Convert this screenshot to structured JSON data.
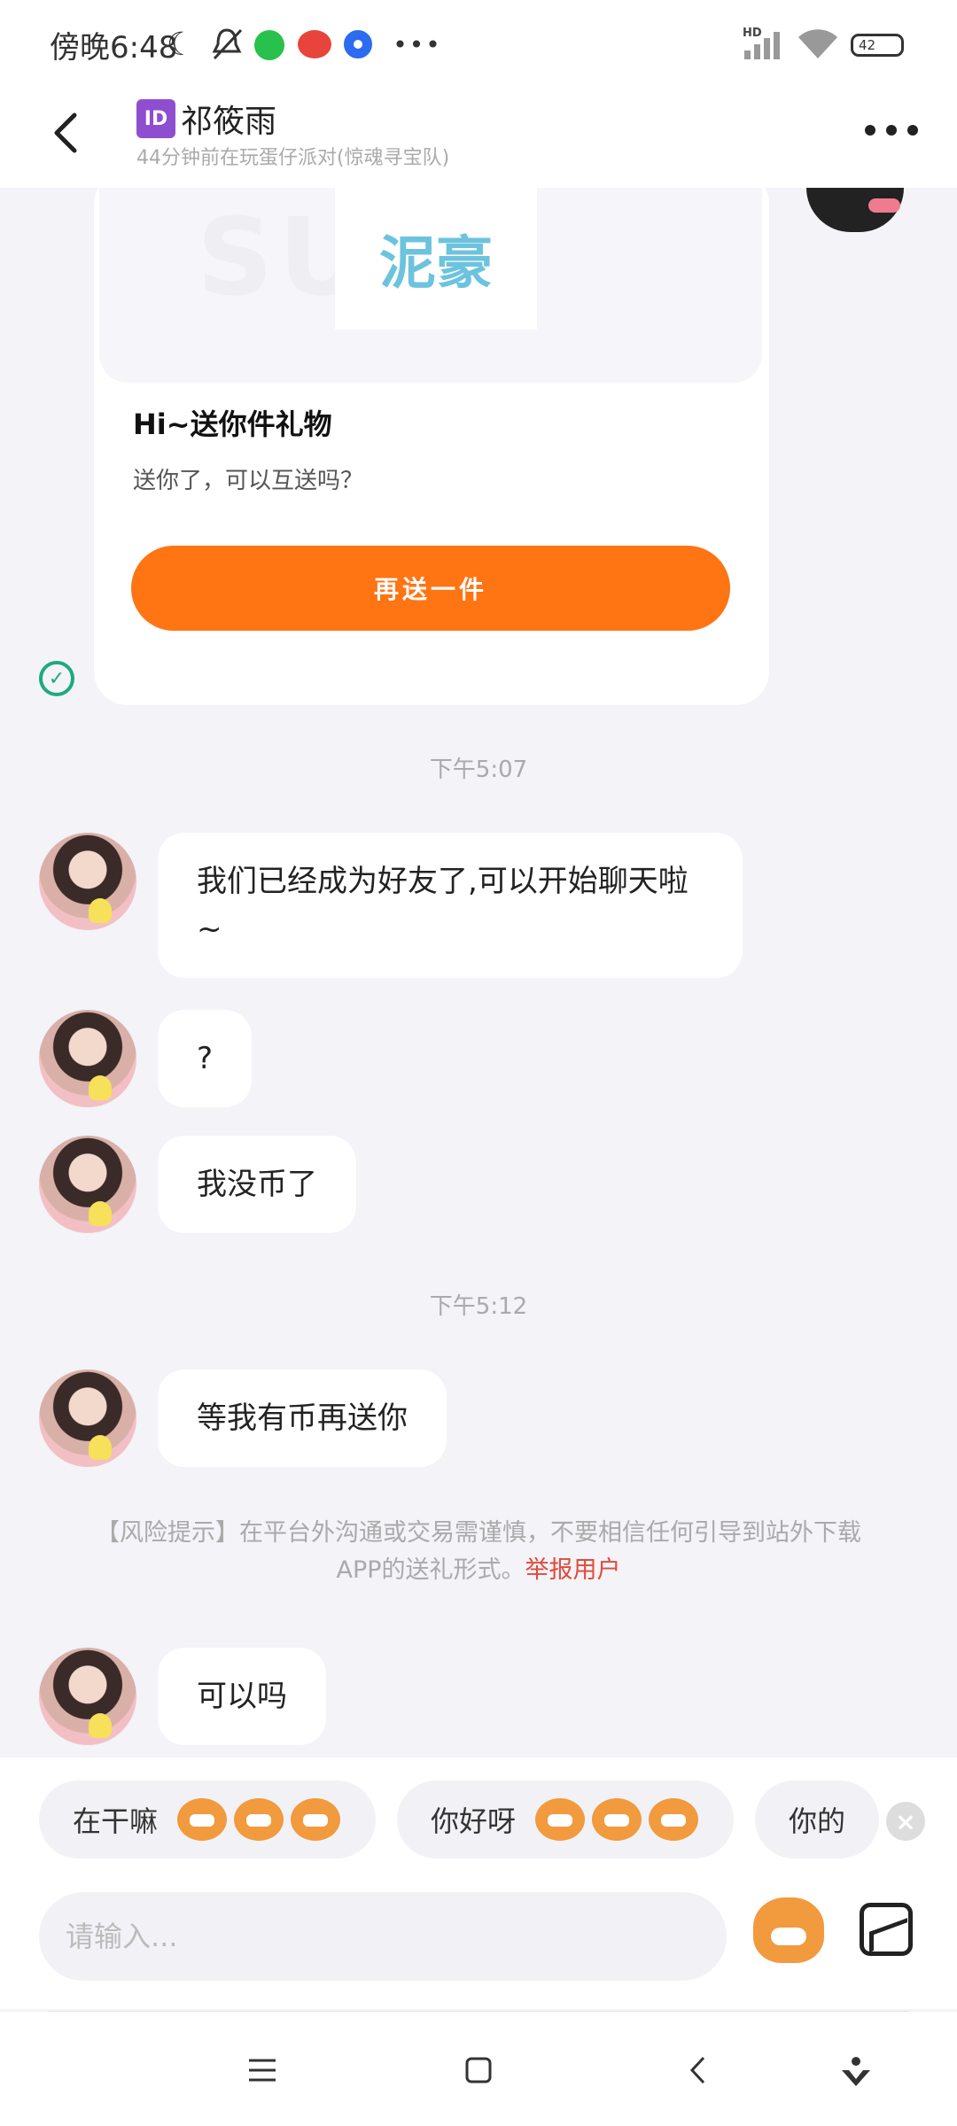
{
  "status_bar": {
    "time": "傍晚6:48",
    "battery": "42",
    "network": "HD"
  },
  "header": {
    "id_badge": "ID",
    "title": "祁筱雨",
    "subtitle": "44分钟前在玩蛋仔派对(惊魂寻宝队)"
  },
  "gift_card": {
    "banner_text": "SURE",
    "logo_text": "泥豪",
    "title": "Hi~送你件礼物",
    "description": "送你了，可以互送吗？",
    "button_label": "再送一件"
  },
  "messages": [
    {
      "time": "下午5:07",
      "text": "我们已经成为好友了,可以开始聊天啦~"
    },
    {
      "text": "?"
    },
    {
      "text": "我没币了"
    },
    {
      "time": "下午5:12",
      "text": "等我有币再送你"
    },
    {
      "text": "可以吗"
    }
  ],
  "risk_notice": {
    "text": "【风险提示】在平台外沟通或交易需谨慎，不要相信任何引导到站外下载APP的送礼形式。",
    "link": "举报用户"
  },
  "quick_replies": [
    "在干嘛",
    "你好呀",
    "你的"
  ],
  "input": {
    "placeholder": "请输入..."
  },
  "icons": {
    "back": "back-arrow-icon",
    "more": "more-dots-icon",
    "check": "check-circle-icon",
    "close": "close-icon",
    "image": "image-icon",
    "mascot": "mascot-icon"
  },
  "colors": {
    "accent": "#ff7413",
    "link": "#e04a3a",
    "check": "#1eaa7e"
  }
}
